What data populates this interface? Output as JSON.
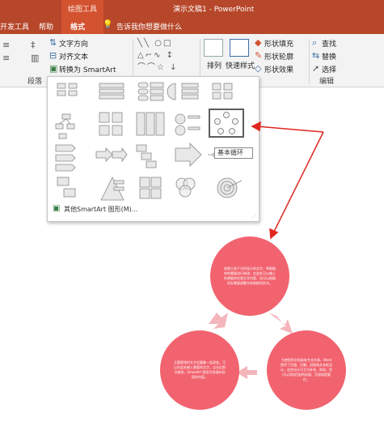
{
  "app": {
    "doc_title": "演示文稿1 - PowerPoint",
    "context_tab_group": "绘图工具",
    "tabs": [
      "开发工具",
      "帮助",
      "格式"
    ],
    "tell_me": "告诉我你想要做什么"
  },
  "ribbon": {
    "text_direction": "文字方向",
    "align_text": "对齐文本",
    "convert_smartart": "转换为 SmartArt",
    "paragraph_group": "段落",
    "arrange": "排列",
    "quick_styles": "快速样式",
    "shape_fill": "形状填充",
    "shape_outline": "形状轮廓",
    "shape_effects": "形状效果",
    "find": "查找",
    "replace": "替换",
    "select": "选择",
    "editing_group": "编辑"
  },
  "gallery": {
    "tooltip": "基本循环",
    "more_label": "其他SmartArt 图形(M)..."
  },
  "slide": {
    "top_text": "绘图工具下方所显示的文字，将根据你的需要进行修改，在此处可以输入你想要的任意文字内容，也可以根据实际需要调整字体和颜色样式。",
    "left_text": "主题更改时文字会跟着一起改变，可以在此处输入需要的文字，点击后即可修改，SmartArt 图形可快速布局您的内容。",
    "right_text": "为使您的文档具有专业外观，Word 提供了页眉、页脚、封面和文本框设计，这些设计可互为补充，例如，您可以添加匹配的封面、页眉和提要栏。"
  },
  "colors": {
    "ribbon_accent": "#b7472a",
    "cycle_fill": "#f1636f",
    "cycle_arrow": "#f4b6bb",
    "annotation_red": "#e0261f"
  }
}
